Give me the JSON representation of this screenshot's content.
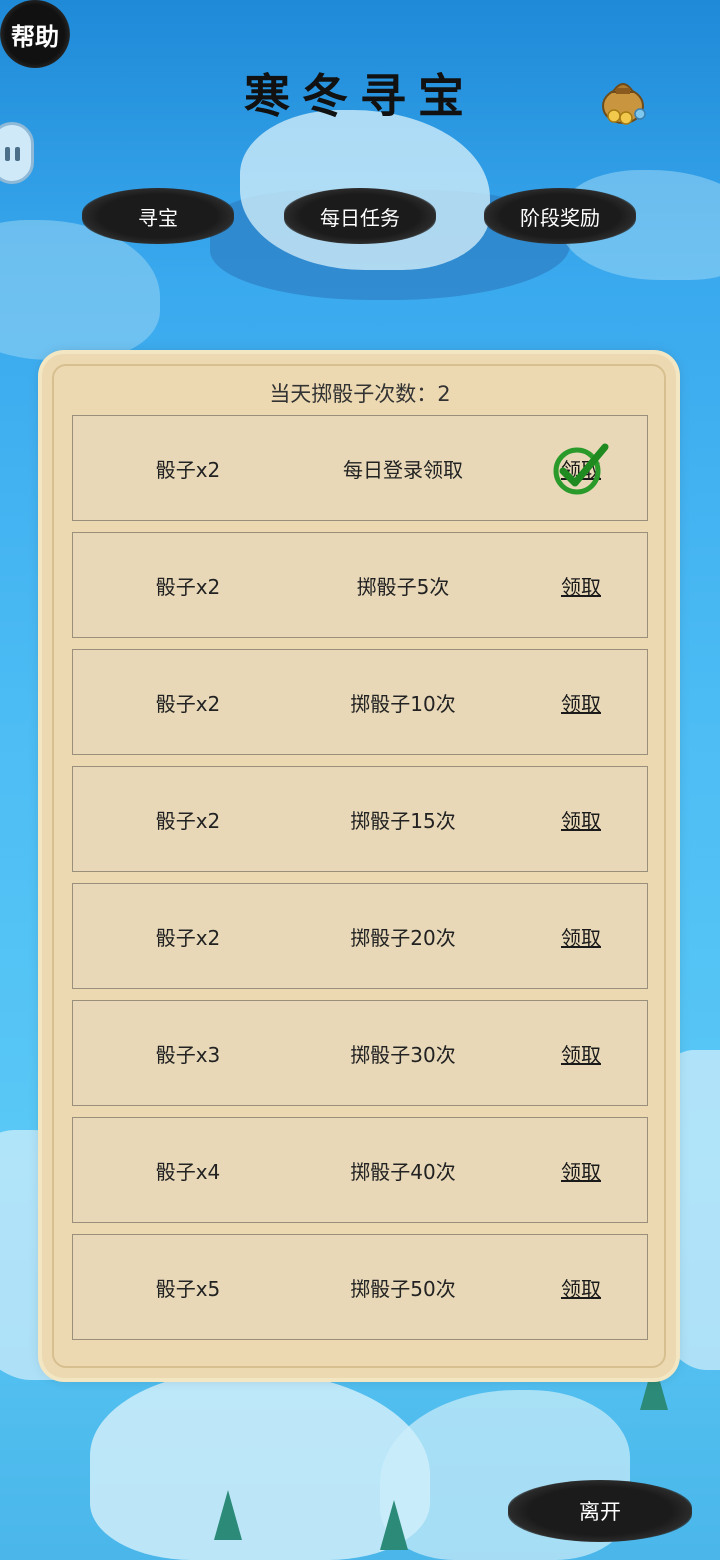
{
  "header": {
    "help_label": "帮助",
    "title": "寒冬寻宝",
    "bag_icon": "treasure-bag-icon"
  },
  "tabs": [
    {
      "label": "寻宝"
    },
    {
      "label": "每日任务"
    },
    {
      "label": "阶段奖励"
    }
  ],
  "panel": {
    "roll_count_text": "当天掷骰子次数：2",
    "tasks": [
      {
        "reward": "骰子x2",
        "condition": "每日登录领取",
        "claim_label": "领取",
        "claimed": true
      },
      {
        "reward": "骰子x2",
        "condition": "掷骰子5次",
        "claim_label": "领取",
        "claimed": false
      },
      {
        "reward": "骰子x2",
        "condition": "掷骰子10次",
        "claim_label": "领取",
        "claimed": false
      },
      {
        "reward": "骰子x2",
        "condition": "掷骰子15次",
        "claim_label": "领取",
        "claimed": false
      },
      {
        "reward": "骰子x2",
        "condition": "掷骰子20次",
        "claim_label": "领取",
        "claimed": false
      },
      {
        "reward": "骰子x3",
        "condition": "掷骰子30次",
        "claim_label": "领取",
        "claimed": false
      },
      {
        "reward": "骰子x4",
        "condition": "掷骰子40次",
        "claim_label": "领取",
        "claimed": false
      },
      {
        "reward": "骰子x5",
        "condition": "掷骰子50次",
        "claim_label": "领取",
        "claimed": false
      }
    ]
  },
  "footer": {
    "leave_label": "离开"
  },
  "colors": {
    "panel_bg": "#ecd9b2",
    "row_bg": "#e8d8b8",
    "check_green": "#2a9a2a"
  }
}
